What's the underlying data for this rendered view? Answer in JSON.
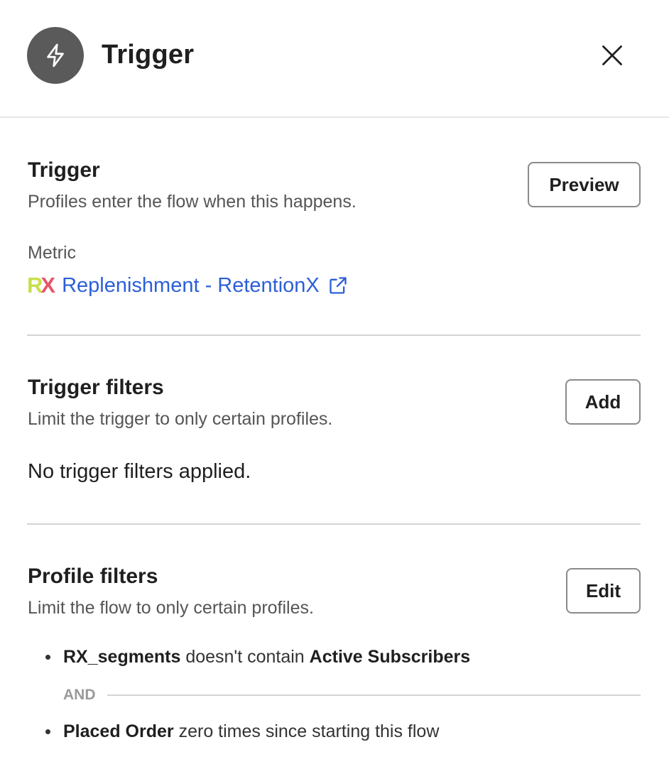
{
  "header": {
    "title": "Trigger",
    "icon": "lightning-bolt-icon"
  },
  "trigger_section": {
    "title": "Trigger",
    "description": "Profiles enter the flow when this happens.",
    "preview_label": "Preview",
    "metric_label": "Metric",
    "metric_logo": {
      "r": "R",
      "x": "X"
    },
    "metric_name": "Replenishment - RetentionX"
  },
  "trigger_filters": {
    "title": "Trigger filters",
    "description": "Limit the trigger to only certain profiles.",
    "add_label": "Add",
    "empty_text": "No trigger filters applied."
  },
  "profile_filters": {
    "title": "Profile filters",
    "description": "Limit the flow to only certain profiles.",
    "edit_label": "Edit",
    "conditions": [
      {
        "subject": "RX_segments",
        "operator": "doesn't contain",
        "value": "Active Subscribers"
      },
      {
        "subject": "Placed Order",
        "operator": "zero times since starting this flow",
        "value": ""
      }
    ],
    "joiner": "AND"
  },
  "colors": {
    "link": "#2c5fd6",
    "icon_bg": "#5a5a5a",
    "logo_r": "#c7e04a",
    "logo_x": "#e8566a"
  }
}
